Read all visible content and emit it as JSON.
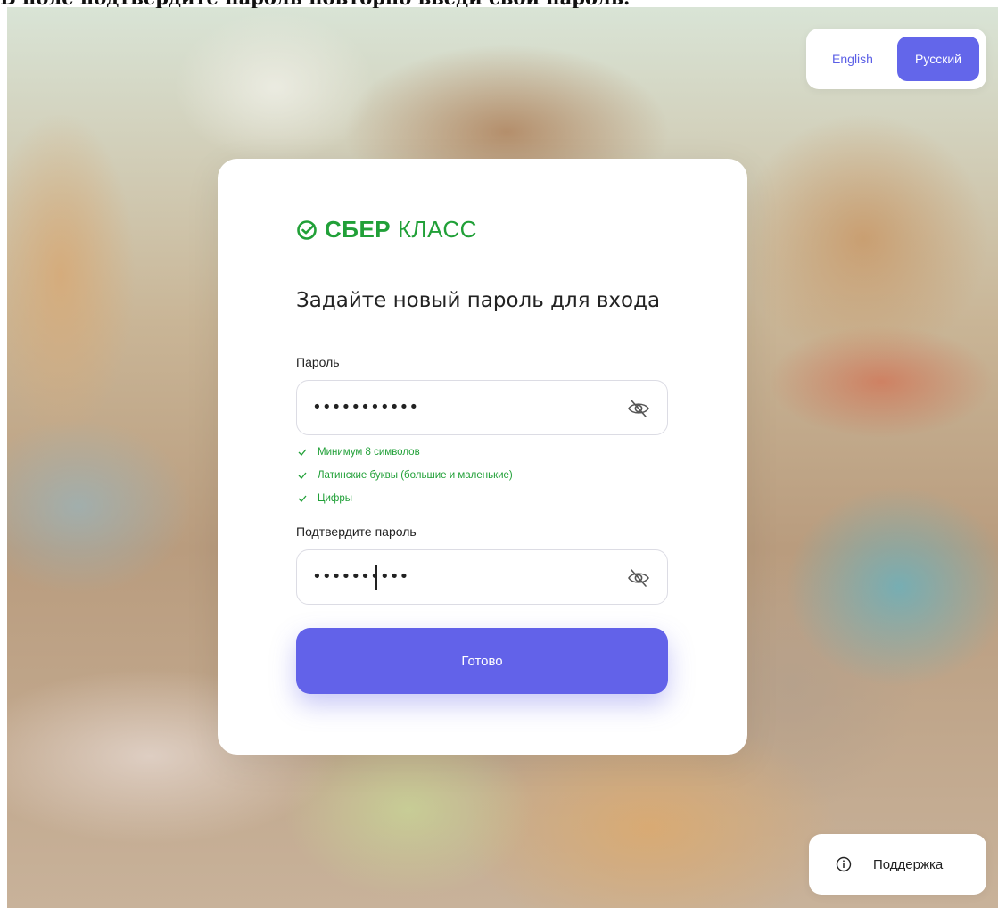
{
  "caption": "В поле подтвердите пароль повторно введи свой пароль.",
  "language_switch": {
    "options": [
      {
        "label": "English",
        "active": false
      },
      {
        "label": "Русский",
        "active": true
      }
    ],
    "accent_color": "#6366ea"
  },
  "logo": {
    "bold": "СБЕР",
    "regular": " КЛАСС",
    "icon": "sber-check-icon",
    "color": "#21a038"
  },
  "form": {
    "title": "Задайте новый пароль для входа",
    "password": {
      "label": "Пароль",
      "value": "•••••••••••",
      "icon": "eye-off-icon"
    },
    "rules": [
      {
        "text": "Минимум 8 символов",
        "status": "ok"
      },
      {
        "text": "Латинские буквы (большие и маленькие)",
        "status": "ok"
      },
      {
        "text": "Цифры",
        "status": "ok"
      }
    ],
    "confirm": {
      "label": "Подтвердите пароль",
      "value": "••••••••••",
      "icon": "eye-off-icon"
    },
    "submit_label": "Готово"
  },
  "support": {
    "label": "Поддержка",
    "icon": "info-icon"
  }
}
